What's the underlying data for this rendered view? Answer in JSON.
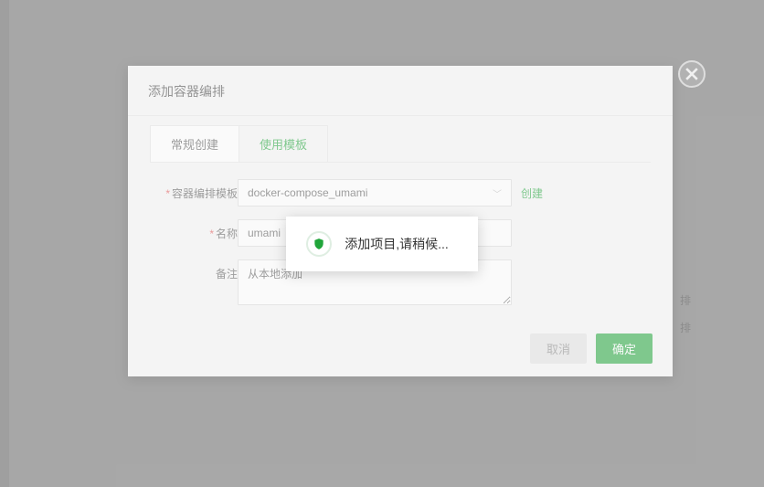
{
  "modal": {
    "title": "添加容器编排",
    "tabs": [
      {
        "label": "常规创建"
      },
      {
        "label": "使用模板"
      }
    ],
    "labels": {
      "template": "容器编排模板",
      "name": "名称",
      "remark": "备注"
    },
    "values": {
      "template_selected": "docker-compose_umami",
      "name": "umami",
      "remark": "从本地添加"
    },
    "actions": {
      "create_link": "创建",
      "cancel": "取消",
      "ok": "确定"
    }
  },
  "toast": {
    "message": "添加项目,请稍候..."
  },
  "background": {
    "line1": "排",
    "line2": "排"
  }
}
